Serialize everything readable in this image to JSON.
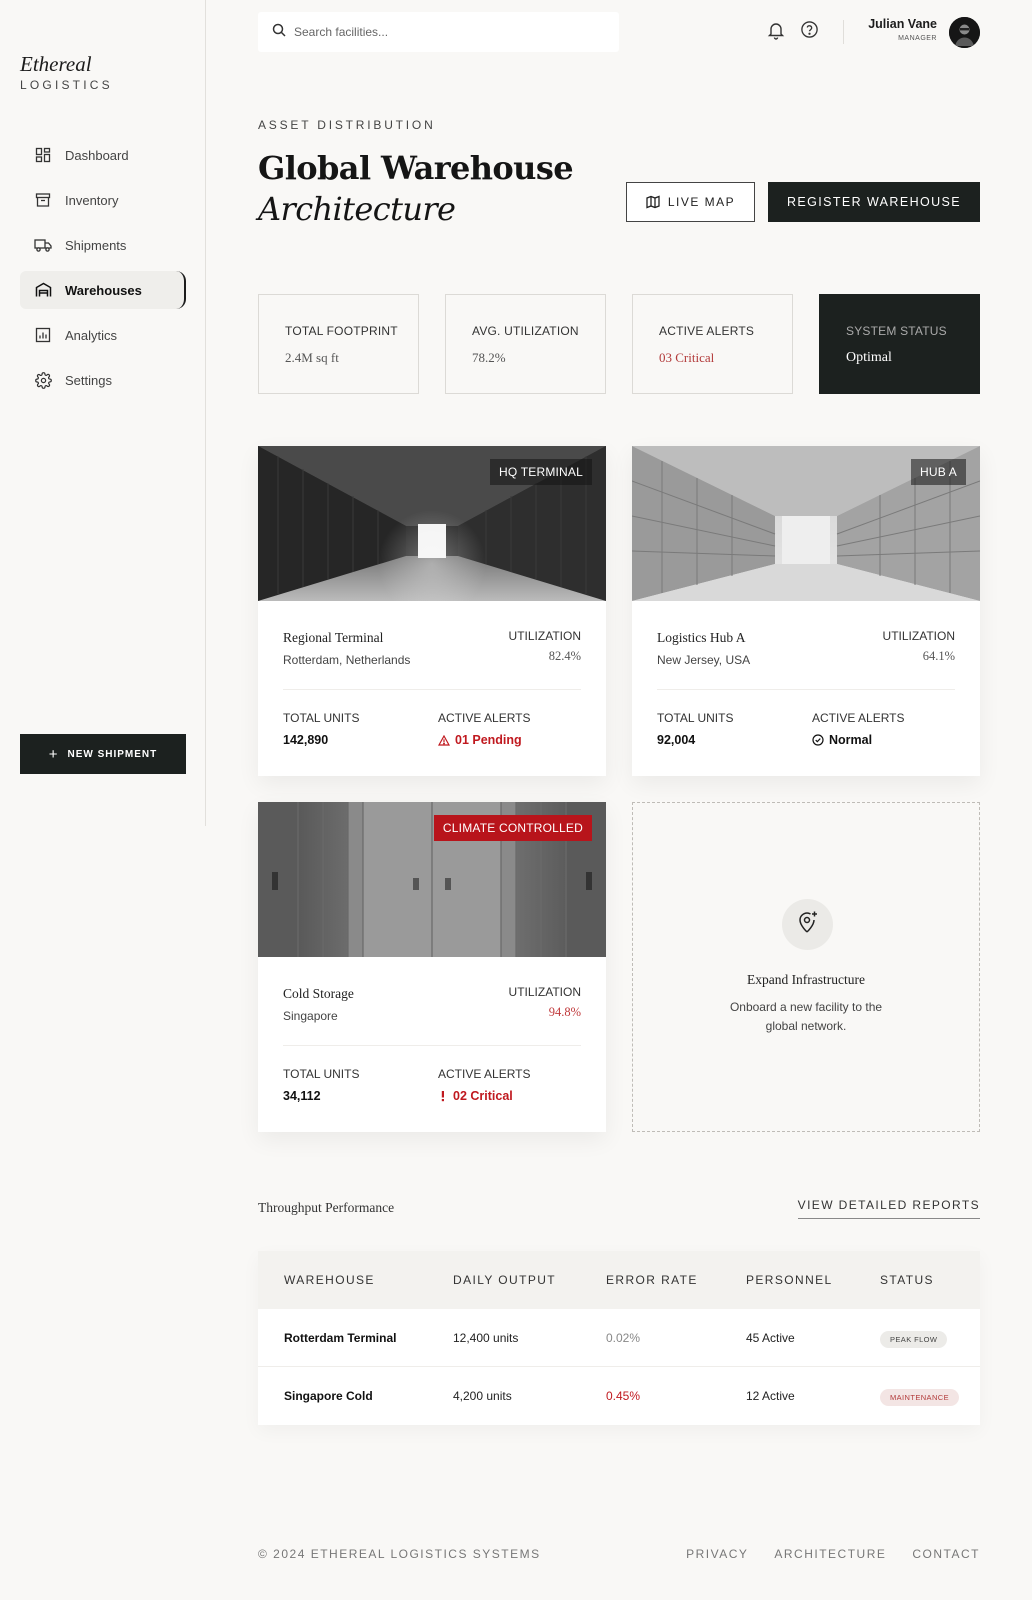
{
  "brand": {
    "name": "Ethereal",
    "sub": "LOGISTICS"
  },
  "sidebar": {
    "items": [
      {
        "label": "Dashboard",
        "icon": "dashboard-icon"
      },
      {
        "label": "Inventory",
        "icon": "archive-icon"
      },
      {
        "label": "Shipments",
        "icon": "truck-icon"
      },
      {
        "label": "Warehouses",
        "icon": "warehouse-icon",
        "active": true
      },
      {
        "label": "Analytics",
        "icon": "chart-icon"
      },
      {
        "label": "Settings",
        "icon": "gear-icon"
      }
    ],
    "new_shipment": "NEW SHIPMENT"
  },
  "header": {
    "search_placeholder": "Search facilities...",
    "user_name": "Julian Vane",
    "user_role": "MANAGER"
  },
  "page": {
    "eyebrow": "ASSET DISTRIBUTION",
    "title_line1": "Global Warehouse",
    "title_line2": "Architecture",
    "live_map": "LIVE MAP",
    "register": "REGISTER WAREHOUSE"
  },
  "stats": [
    {
      "label": "TOTAL FOOTPRINT",
      "value": "2.4M sq ft"
    },
    {
      "label": "AVG. UTILIZATION",
      "value": "78.2%"
    },
    {
      "label": "ACTIVE ALERTS",
      "value": "03 Critical"
    },
    {
      "label": "SYSTEM STATUS",
      "value": "Optimal"
    }
  ],
  "cards": [
    {
      "badge": "HQ TERMINAL",
      "name": "Regional Terminal",
      "location": "Rotterdam, Netherlands",
      "util_label": "UTILIZATION",
      "util": "82.4%",
      "units_label": "TOTAL UNITS",
      "units": "142,890",
      "alerts_label": "ACTIVE ALERTS",
      "alerts": "01 Pending"
    },
    {
      "badge": "HUB A",
      "name": "Logistics Hub A",
      "location": "New Jersey, USA",
      "util_label": "UTILIZATION",
      "util": "64.1%",
      "units_label": "TOTAL UNITS",
      "units": "92,004",
      "alerts_label": "ACTIVE ALERTS",
      "alerts": "Normal"
    },
    {
      "badge": "CLIMATE CONTROLLED",
      "name": "Cold Storage",
      "location": "Singapore",
      "util_label": "UTILIZATION",
      "util": "94.8%",
      "units_label": "TOTAL UNITS",
      "units": "34,112",
      "alerts_label": "ACTIVE ALERTS",
      "alerts": "02 Critical"
    }
  ],
  "expand": {
    "title": "Expand Infrastructure",
    "desc": "Onboard a new facility to the global network."
  },
  "throughput": {
    "title": "Throughput Performance",
    "link": "VIEW DETAILED REPORTS",
    "headers": [
      "WAREHOUSE",
      "DAILY OUTPUT",
      "ERROR RATE",
      "PERSONNEL",
      "STATUS"
    ],
    "rows": [
      [
        "Rotterdam Terminal",
        "12,400 units",
        "0.02%",
        "45 Active",
        "PEAK FLOW"
      ],
      [
        "Singapore Cold",
        "4,200 units",
        "0.45%",
        "12 Active",
        "MAINTENANCE"
      ]
    ]
  },
  "footer": {
    "copyright": "© 2024 ETHEREAL LOGISTICS SYSTEMS",
    "links": [
      "PRIVACY",
      "ARCHITECTURE",
      "CONTACT"
    ]
  },
  "colors": {
    "accent_dark": "#1c211f",
    "critical": "#c0191f",
    "background": "#f9f8f6"
  }
}
